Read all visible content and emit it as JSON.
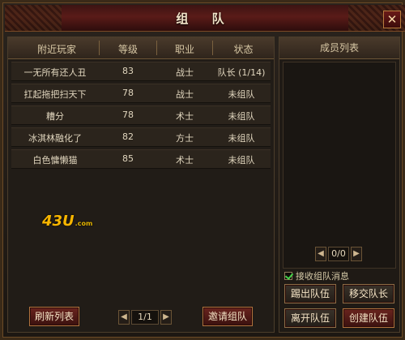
{
  "window": {
    "title": "组 队",
    "close_glyph": "✕"
  },
  "left": {
    "columns": [
      "附近玩家",
      "等级",
      "职业",
      "状态"
    ],
    "rows": [
      {
        "name": "一无所有还人丑",
        "level": "83",
        "class": "战士",
        "status": "队长 (1/14)"
      },
      {
        "name": "扛起拖把扫天下",
        "level": "78",
        "class": "战士",
        "status": "未组队"
      },
      {
        "name": "糟分",
        "level": "78",
        "class": "术士",
        "status": "未组队"
      },
      {
        "name": "冰淇林融化了",
        "level": "82",
        "class": "方士",
        "status": "未组队"
      },
      {
        "name": "白色慵懒猫",
        "level": "85",
        "class": "术士",
        "status": "未组队"
      }
    ],
    "logo": {
      "main": "43U",
      "small": ".com"
    },
    "buttons": {
      "refresh": "刷新列表",
      "invite": "邀请组队"
    },
    "pager": {
      "value": "1/1",
      "prev": "◀",
      "next": "▶"
    }
  },
  "right": {
    "header": "成员列表",
    "pager": {
      "value": "0/0",
      "prev": "◀",
      "next": "▶"
    },
    "receive_messages_label": "接收组队消息",
    "buttons": {
      "kick": "踢出队伍",
      "transfer": "移交队长",
      "leave": "离开队伍",
      "create": "创建队伍"
    }
  },
  "colors": {
    "accent": "#b0723d",
    "title_bg": "#5a1b18"
  }
}
